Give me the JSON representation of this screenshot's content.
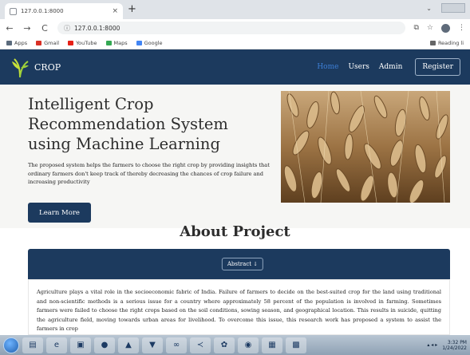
{
  "browser": {
    "tab_title": "127.0.0.1:8000",
    "tab_close": "×",
    "new_tab": "+",
    "url": "127.0.0.1:8000",
    "bookmarks": [
      {
        "label": "Apps",
        "icon": "apps-grid-icon",
        "color": "#5b6b7c"
      },
      {
        "label": "Gmail",
        "icon": "gmail-icon",
        "color": "#d93025"
      },
      {
        "label": "YouTube",
        "icon": "youtube-icon",
        "color": "#e62117"
      },
      {
        "label": "Maps",
        "icon": "maps-icon",
        "color": "#34a853"
      },
      {
        "label": "Google",
        "icon": "google-icon",
        "color": "#4285f4"
      }
    ],
    "reading_list": "Reading li"
  },
  "site": {
    "brand": "CROP",
    "nav": [
      {
        "label": "Home",
        "active": true
      },
      {
        "label": "Users",
        "active": false
      },
      {
        "label": "Admin",
        "active": false
      }
    ],
    "register_label": "Register",
    "colors": {
      "navbar": "#1c3a5e",
      "active_link": "#3d7fd6"
    }
  },
  "hero": {
    "title": "Intelligent Crop Recommendation System using Machine Learning",
    "description": "The proposed system helps the farmers to choose the right crop by providing insights that ordinary farmers don't keep track of thereby decreasing the chances of crop failure and increasing productivity",
    "button_label": "Learn More"
  },
  "about": {
    "title": "About Project",
    "abstract_label": "Abstract ↓",
    "body": "Agriculture plays a vital role in the socioeconomic fabric of India. Failure of farmers to decide on the best-suited crop for the land using traditional and non-scientific methods is a serious issue for a country where approximately 58 percent of the population is involved in farming. Sometimes farmers were failed to choose the right crops based on the soil conditions, sowing season, and geographical location. This results in suicide, quitting the agriculture field, moving towards urban areas for livelihood. To overcome this issue, this research work has proposed a system to assist the farmers in crop"
  },
  "taskbar": {
    "apps": [
      "folder-icon",
      "ie-icon",
      "sts-icon",
      "chrome-icon",
      "vlc-icon",
      "visual-studio-icon",
      "arduino-icon",
      "vscode-icon",
      "paint-icon",
      "firefox-icon",
      "notepad-icon",
      "terminal-icon"
    ],
    "time": "3:32 PM",
    "date": "1/24/2022"
  }
}
